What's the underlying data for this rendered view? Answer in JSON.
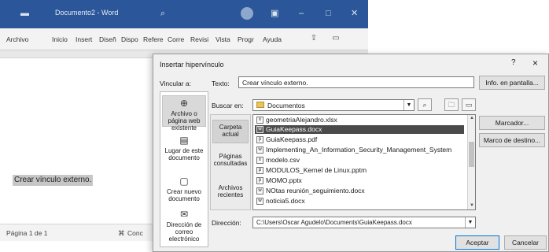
{
  "word": {
    "title": "Documento2 - Word",
    "tabs": [
      "Archivo",
      "Inicio",
      "Insert",
      "Diseñ",
      "Dispo",
      "Refere",
      "Corre",
      "Revisi",
      "Vista",
      "Progr",
      "Ayuda"
    ],
    "selected_text": "Crear vínculo externo.",
    "status_page": "Página 1 de 1",
    "status_right": "Conc"
  },
  "dialog": {
    "title": "Insertar hipervínculo",
    "help": "?",
    "close": "×",
    "link_to_label": "Vincular a:",
    "text_label": "Texto:",
    "text_value": "Crear vínculo externo.",
    "screen_tip_button": "Info. en pantalla...",
    "look_in_label": "Buscar en:",
    "look_in_value": "Documentos",
    "link_to_items": [
      "Archivo o página web existente",
      "Lugar de este documento",
      "Crear nuevo documento",
      "Dirección de correo electrónico"
    ],
    "sub_items": [
      "Carpeta actual",
      "Páginas consultadas",
      "Archivos recientes"
    ],
    "files": [
      "geometriaAlejandro.xlsx",
      "GuiaKeepass.docx",
      "GuiaKeepass.pdf",
      "Implementing_An_Information_Security_Management_System",
      "modelo.csv",
      "MODULOS_Kernel de Linux.pptm",
      "MOMO.pptx",
      "NOtas reunión_seguimiento.docx",
      "noticia5.docx"
    ],
    "selected_file_index": 1,
    "bookmark_button": "Marcador...",
    "target_frame_button": "Marco de destino...",
    "address_label": "Dirección:",
    "address_value": "C:\\Users\\Oscar Agudelo\\Documents\\GuiaKeepass.docx",
    "ok_button": "Aceptar",
    "cancel_button": "Cancelar"
  },
  "colors": {
    "title_bar": "#2b579a",
    "selection": "#4a4a4a",
    "dialog_bg": "#f0f0f0"
  }
}
